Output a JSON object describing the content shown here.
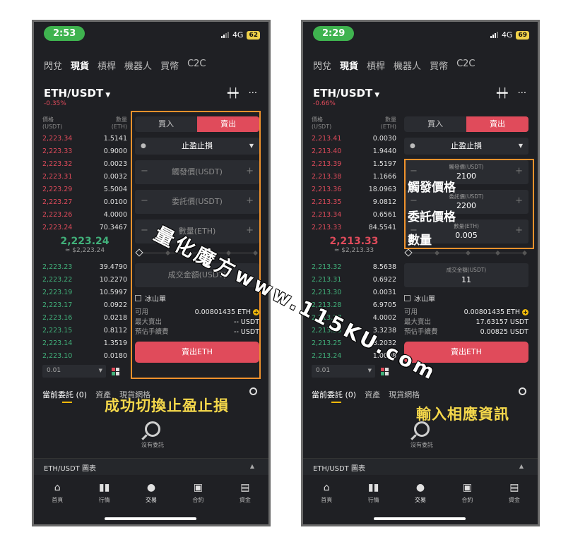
{
  "left": {
    "time": "2:53",
    "network": "4G",
    "battery": "62",
    "tabs": [
      "閃兌",
      "現貨",
      "槓桿",
      "機器人",
      "買幣",
      "C2C"
    ],
    "pair": "ETH/USDT",
    "change": "-0.35%",
    "ob_head": {
      "price": "價格",
      "price_unit": "(USDT)",
      "qty": "數量",
      "qty_unit": "(ETH)"
    },
    "asks": [
      {
        "p": "2,223.34",
        "q": "1.5141"
      },
      {
        "p": "2,223.33",
        "q": "0.9000"
      },
      {
        "p": "2,223.32",
        "q": "0.0023"
      },
      {
        "p": "2,223.31",
        "q": "0.0032"
      },
      {
        "p": "2,223.29",
        "q": "5.5004"
      },
      {
        "p": "2,223.27",
        "q": "0.0100"
      },
      {
        "p": "2,223.26",
        "q": "4.0000"
      },
      {
        "p": "2,223.24",
        "q": "70.3467"
      }
    ],
    "last_price": "2,223.24",
    "ref_price": "≈ $2,223.24",
    "bids": [
      {
        "p": "2,223.23",
        "q": "39.4790"
      },
      {
        "p": "2,223.22",
        "q": "10.2270"
      },
      {
        "p": "2,223.19",
        "q": "10.5997"
      },
      {
        "p": "2,223.17",
        "q": "0.0922"
      },
      {
        "p": "2,223.16",
        "q": "0.0218"
      },
      {
        "p": "2,223.15",
        "q": "0.8112"
      },
      {
        "p": "2,223.14",
        "q": "1.3519"
      },
      {
        "p": "2,223.10",
        "q": "0.0180"
      }
    ],
    "precision": "0.01",
    "buy_label": "買入",
    "sell_label": "賣出",
    "order_type": "止盈止損",
    "trigger_ph": "觸發價(USDT)",
    "order_price_ph": "委託價(USDT)",
    "qty_ph": "數量(ETH)",
    "total_ph": "成交金額(USDT)",
    "iceberg": "冰山單",
    "avail_k": "可用",
    "avail_v": "0.00801435 ETH",
    "max_k": "最大賣出",
    "max_v": "-- USDT",
    "fee_k": "預估手續費",
    "fee_v": "-- USDT",
    "submit": "賣出ETH",
    "orders_tabs": [
      "當前委託 (0)",
      "資產",
      "現貨網格"
    ],
    "empty": "沒有委託",
    "chart_bar": "ETH/USDT 圖表",
    "nav": [
      "首頁",
      "行情",
      "交易",
      "合約",
      "資金"
    ],
    "caption": "成功切換止盈止損"
  },
  "right": {
    "time": "2:29",
    "network": "4G",
    "battery": "69",
    "tabs": [
      "閃兌",
      "現貨",
      "槓桿",
      "機器人",
      "買幣",
      "C2C"
    ],
    "pair": "ETH/USDT",
    "change": "-0.66%",
    "ob_head": {
      "price": "價格",
      "price_unit": "(USDT)",
      "qty": "數量",
      "qty_unit": "(ETH)"
    },
    "asks": [
      {
        "p": "2,213.41",
        "q": "0.0030"
      },
      {
        "p": "2,213.40",
        "q": "1.9440"
      },
      {
        "p": "2,213.39",
        "q": "1.5197"
      },
      {
        "p": "2,213.38",
        "q": "1.1666"
      },
      {
        "p": "2,213.36",
        "q": "18.0963"
      },
      {
        "p": "2,213.35",
        "q": "9.0812"
      },
      {
        "p": "2,213.34",
        "q": "0.6561"
      },
      {
        "p": "2,213.33",
        "q": "84.5541"
      }
    ],
    "last_price": "2,213.33",
    "ref_price": "≈ $2,213.33",
    "bids": [
      {
        "p": "2,213.32",
        "q": "8.5638"
      },
      {
        "p": "2,213.31",
        "q": "0.6922"
      },
      {
        "p": "2,213.30",
        "q": "0.0031"
      },
      {
        "p": "2,213.28",
        "q": "6.9705"
      },
      {
        "p": "2,213.27",
        "q": "4.0002"
      },
      {
        "p": "2,213.26",
        "q": "3.3238"
      },
      {
        "p": "2,213.25",
        "q": "8.2032"
      },
      {
        "p": "2,213.24",
        "q": "1.0098"
      }
    ],
    "precision": "0.01",
    "buy_label": "買入",
    "sell_label": "賣出",
    "order_type": "止盈止損",
    "trigger_label": "觸發價(USDT)",
    "trigger_val": "2100",
    "order_price_label": "委託價(USDT)",
    "order_price_val": "2200",
    "qty_label": "數量(ETH)",
    "qty_val": "0.005",
    "total_label": "成交金額(USDT)",
    "total_val": "11",
    "iceberg": "冰山單",
    "avail_k": "可用",
    "avail_v": "0.00801435 ETH",
    "max_k": "最大賣出",
    "max_v": "17.63157 USDT",
    "fee_k": "預估手續費",
    "fee_v": "0.00825 USDT",
    "submit": "賣出ETH",
    "orders_tabs": [
      "當前委託 (0)",
      "資產",
      "現貨網格"
    ],
    "empty": "沒有委託",
    "chart_bar": "ETH/USDT 圖表",
    "nav": [
      "首頁",
      "行情",
      "交易",
      "合約",
      "資金"
    ],
    "caption": "輸入相應資訊",
    "label_trigger": "觸發價格",
    "label_order": "委託價格",
    "label_qty": "數量"
  },
  "watermark": "量化魔方www.115KU.com",
  "colors": {
    "ask": "#e04b5b",
    "bid": "#41b07a",
    "highlight": "#f0922c",
    "caption": "#f5d84b",
    "accent": "#f0b90b"
  }
}
